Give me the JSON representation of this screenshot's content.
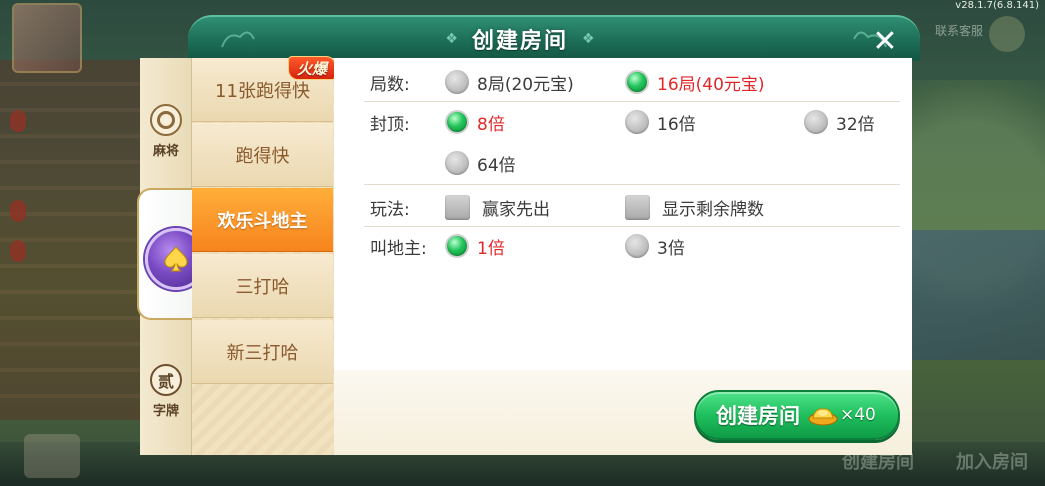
{
  "version": "v28.1.7(6.8.141)",
  "background": {
    "service_label": "联系客服",
    "bottom_labels": [
      "创建房间",
      "加入房间"
    ]
  },
  "dialog": {
    "title": "创建房间",
    "close_icon": "close-icon"
  },
  "categories": [
    {
      "label": "麻将",
      "icon": "mahjong-tile-icon"
    },
    {
      "label": "",
      "icon": "spade-icon",
      "active": true
    },
    {
      "label": "字牌",
      "icon": "zi-character-icon",
      "glyph": "贰"
    }
  ],
  "games": [
    {
      "label": "11张跑得快",
      "hot": true
    },
    {
      "label": "跑得快"
    },
    {
      "label": "欢乐斗地主",
      "active": true
    },
    {
      "label": "三打哈"
    },
    {
      "label": "新三打哈"
    }
  ],
  "hot_tag": "火爆",
  "options": {
    "rounds": {
      "label": "局数:",
      "choices": [
        {
          "text": "8局(20元宝)",
          "selected": false
        },
        {
          "text": "16局(40元宝)",
          "selected": true
        }
      ]
    },
    "cap": {
      "label": "封顶:",
      "choices": [
        {
          "text": "8倍",
          "selected": true
        },
        {
          "text": "16倍",
          "selected": false
        },
        {
          "text": "32倍",
          "selected": false
        },
        {
          "text": "64倍",
          "selected": false
        }
      ]
    },
    "rules": {
      "label": "玩法:",
      "choices": [
        {
          "text": "赢家先出",
          "checked": false
        },
        {
          "text": "显示剩余牌数",
          "checked": false
        }
      ]
    },
    "landlord": {
      "label": "叫地主:",
      "choices": [
        {
          "text": "1倍",
          "selected": true
        },
        {
          "text": "3倍",
          "selected": false
        }
      ]
    }
  },
  "create_button": {
    "label": "创建房间",
    "cost": "×40",
    "icon": "gold-ingot-icon"
  },
  "colors": {
    "selected_text": "#e0282a",
    "active_game": "#f7841e",
    "create_button": "#1fbf5e",
    "header": "#1d6e56"
  }
}
